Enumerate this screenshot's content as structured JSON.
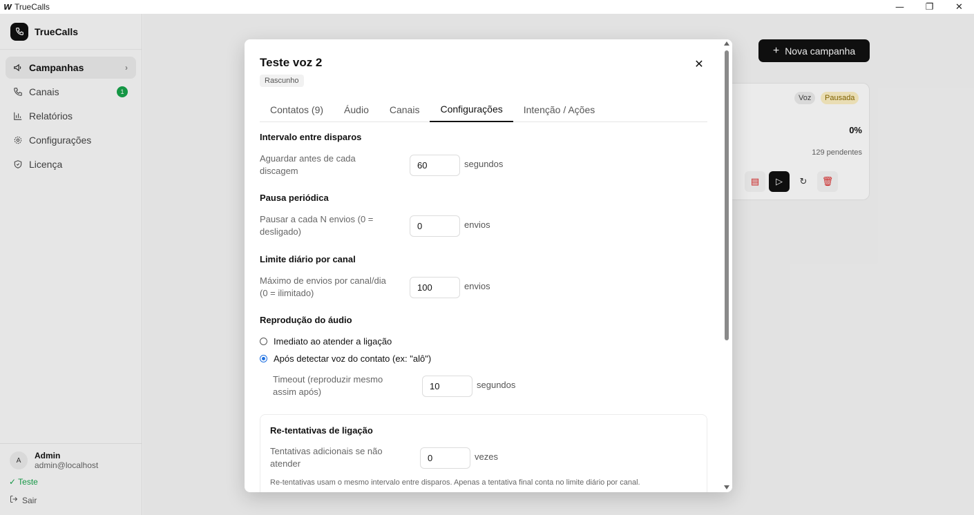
{
  "window": {
    "title": "TrueCalls",
    "app_glyph": "W"
  },
  "sidebar": {
    "brand": "TrueCalls",
    "items": [
      {
        "label": "Campanhas",
        "icon": "megaphone-icon",
        "active": true
      },
      {
        "label": "Canais",
        "icon": "phone-icon",
        "badge": "1"
      },
      {
        "label": "Relatórios",
        "icon": "bar-chart-icon"
      },
      {
        "label": "Configurações",
        "icon": "gear-icon"
      },
      {
        "label": "Licença",
        "icon": "shield-icon"
      }
    ],
    "user": {
      "initial": "A",
      "name": "Admin",
      "email": "admin@localhost"
    },
    "license_status": "✓ Teste",
    "logout_label": "Sair"
  },
  "main": {
    "new_campaign_label": "Nova campanha",
    "card": {
      "tag_type": "Voz",
      "tag_status": "Pausada",
      "progress": "0%",
      "pending": "129 pendentes"
    }
  },
  "modal": {
    "title": "Teste voz 2",
    "status_badge": "Rascunho",
    "tabs": [
      "Contatos (9)",
      "Áudio",
      "Canais",
      "Configurações",
      "Intenção / Ações"
    ],
    "active_tab": "Configurações",
    "interval": {
      "title": "Intervalo entre disparos",
      "label": "Aguardar antes de cada discagem",
      "value": "60",
      "unit": "segundos"
    },
    "pause": {
      "title": "Pausa periódica",
      "label": "Pausar a cada N envios (0 = desligado)",
      "value": "0",
      "unit": "envios"
    },
    "daily_limit": {
      "title": "Limite diário por canal",
      "label": "Máximo de envios por canal/dia (0 = ilimitado)",
      "value": "100",
      "unit": "envios"
    },
    "playback": {
      "title": "Reprodução do áudio",
      "option_immediate": "Imediato ao atender a ligação",
      "option_voice": "Após detectar voz do contato (ex: \"alô\")",
      "selected": "voice",
      "timeout_label": "Timeout (reproduzir mesmo assim após)",
      "timeout_value": "10",
      "timeout_unit": "segundos"
    },
    "retries": {
      "title": "Re-tentativas de ligação",
      "label": "Tentativas adicionais se não atender",
      "value": "0",
      "unit": "vezes",
      "note": "Re-tentativas usam o mesmo intervalo entre disparos. Apenas a tentativa final conta no limite diário por canal."
    }
  },
  "colors": {
    "accent": "#111111",
    "radio": "#1d6fe0",
    "success": "#16a34a",
    "danger": "#dc2626"
  }
}
